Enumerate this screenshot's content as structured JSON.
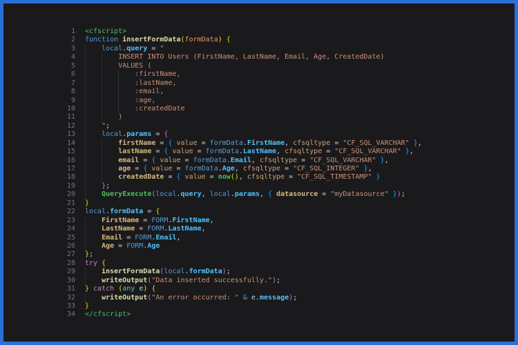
{
  "window": {
    "border_color": "#2a70d8",
    "background_color": "#1a1a1c",
    "gutter_color": "#6e7681",
    "language": "cfscript"
  },
  "palette": {
    "kw": "#569CD6",
    "v": "#569CD6",
    "pr": "#4FC1FF",
    "fn": "#DCDCAA",
    "param": "#E8956D",
    "key": "#D7BA7D",
    "attr": "#D2A176",
    "str": "#CE9178",
    "tag": "#4BC161",
    "grn": "#4BC161",
    "pink": "#C586C0",
    "teal": "#4EC9B0",
    "cy": "#9CDCFE",
    "p": "#D4D4D4",
    "g": "#FFD700",
    "o": "#DA70D6",
    "b": "#179FFF"
  },
  "code": {
    "lines": [
      {
        "n": "1",
        "t": [
          [
            "tag",
            "<cfscript>"
          ]
        ]
      },
      {
        "n": "2",
        "t": [
          [
            "kw",
            "function "
          ],
          [
            "fn",
            "insertFormData"
          ],
          [
            "g",
            "("
          ],
          [
            "param",
            "formData"
          ],
          [
            "g",
            ")"
          ],
          [
            "p",
            " "
          ],
          [
            "g",
            "{"
          ]
        ]
      },
      {
        "n": "3",
        "t": [
          [
            "p",
            "    "
          ],
          [
            "v",
            "local"
          ],
          [
            "p",
            "."
          ],
          [
            "pr",
            "query"
          ],
          [
            "p",
            " = "
          ],
          [
            "str",
            "\""
          ]
        ]
      },
      {
        "n": "4",
        "t": [
          [
            "str",
            "        INSERT INTO Users (FirstName, LastName, Email, Age, CreatedDate)"
          ]
        ]
      },
      {
        "n": "5",
        "t": [
          [
            "str",
            "        VALUES ("
          ]
        ]
      },
      {
        "n": "6",
        "t": [
          [
            "str",
            "            :firstName,"
          ]
        ]
      },
      {
        "n": "7",
        "t": [
          [
            "str",
            "            :lastName,"
          ]
        ]
      },
      {
        "n": "8",
        "t": [
          [
            "str",
            "            :email,"
          ]
        ]
      },
      {
        "n": "9",
        "t": [
          [
            "str",
            "            :age,"
          ]
        ]
      },
      {
        "n": "10",
        "t": [
          [
            "str",
            "            :createdDate"
          ]
        ]
      },
      {
        "n": "11",
        "t": [
          [
            "str",
            "        )"
          ]
        ]
      },
      {
        "n": "12",
        "t": [
          [
            "p",
            "    "
          ],
          [
            "str",
            "\""
          ],
          [
            "p",
            ";"
          ]
        ]
      },
      {
        "n": "13",
        "t": [
          [
            "p",
            "    "
          ],
          [
            "v",
            "local"
          ],
          [
            "p",
            "."
          ],
          [
            "pr",
            "params"
          ],
          [
            "p",
            " = "
          ],
          [
            "o",
            "{"
          ]
        ]
      },
      {
        "n": "14",
        "t": [
          [
            "p",
            "        "
          ],
          [
            "key",
            "firstName"
          ],
          [
            "p",
            " = "
          ],
          [
            "b",
            "{"
          ],
          [
            "p",
            " "
          ],
          [
            "attr",
            "value"
          ],
          [
            "p",
            " = "
          ],
          [
            "v",
            "formData"
          ],
          [
            "p",
            "."
          ],
          [
            "pr",
            "FirstName"
          ],
          [
            "p",
            ", "
          ],
          [
            "attr",
            "cfsqltype"
          ],
          [
            "p",
            " = "
          ],
          [
            "str",
            "\"CF_SQL_VARCHAR\""
          ],
          [
            "p",
            " "
          ],
          [
            "b",
            "}"
          ],
          [
            "p",
            ","
          ]
        ]
      },
      {
        "n": "15",
        "t": [
          [
            "p",
            "        "
          ],
          [
            "key",
            "lastName"
          ],
          [
            "p",
            " = "
          ],
          [
            "b",
            "{"
          ],
          [
            "p",
            " "
          ],
          [
            "attr",
            "value"
          ],
          [
            "p",
            " = "
          ],
          [
            "v",
            "formData"
          ],
          [
            "p",
            "."
          ],
          [
            "pr",
            "LastName"
          ],
          [
            "p",
            ", "
          ],
          [
            "attr",
            "cfsqltype"
          ],
          [
            "p",
            " = "
          ],
          [
            "str",
            "\"CF_SQL_VARCHAR\""
          ],
          [
            "p",
            " "
          ],
          [
            "b",
            "}"
          ],
          [
            "p",
            ","
          ]
        ]
      },
      {
        "n": "16",
        "t": [
          [
            "p",
            "        "
          ],
          [
            "key",
            "email"
          ],
          [
            "p",
            " = "
          ],
          [
            "b",
            "{"
          ],
          [
            "p",
            " "
          ],
          [
            "attr",
            "value"
          ],
          [
            "p",
            " = "
          ],
          [
            "v",
            "formData"
          ],
          [
            "p",
            "."
          ],
          [
            "pr",
            "Email"
          ],
          [
            "p",
            ", "
          ],
          [
            "attr",
            "cfsqltype"
          ],
          [
            "p",
            " = "
          ],
          [
            "str",
            "\"CF_SQL_VARCHAR\""
          ],
          [
            "p",
            " "
          ],
          [
            "b",
            "}"
          ],
          [
            "p",
            ","
          ]
        ]
      },
      {
        "n": "17",
        "t": [
          [
            "p",
            "        "
          ],
          [
            "key",
            "age"
          ],
          [
            "p",
            " = "
          ],
          [
            "b",
            "{"
          ],
          [
            "p",
            " "
          ],
          [
            "attr",
            "value"
          ],
          [
            "p",
            " = "
          ],
          [
            "v",
            "formData"
          ],
          [
            "p",
            "."
          ],
          [
            "pr",
            "Age"
          ],
          [
            "p",
            ", "
          ],
          [
            "attr",
            "cfsqltype"
          ],
          [
            "p",
            " = "
          ],
          [
            "str",
            "\"CF_SQL_INTEGER\""
          ],
          [
            "p",
            " "
          ],
          [
            "b",
            "}"
          ],
          [
            "p",
            ","
          ]
        ]
      },
      {
        "n": "18",
        "t": [
          [
            "p",
            "        "
          ],
          [
            "key",
            "createdDate"
          ],
          [
            "p",
            " = "
          ],
          [
            "b",
            "{"
          ],
          [
            "p",
            " "
          ],
          [
            "attr",
            "value"
          ],
          [
            "p",
            " = "
          ],
          [
            "grn",
            "now"
          ],
          [
            "g",
            "()"
          ],
          [
            "p",
            ", "
          ],
          [
            "attr",
            "cfsqltype"
          ],
          [
            "p",
            " = "
          ],
          [
            "str",
            "\"CF_SQL_TIMESTAMP\""
          ],
          [
            "p",
            " "
          ],
          [
            "b",
            "}"
          ]
        ]
      },
      {
        "n": "19",
        "t": [
          [
            "p",
            "    "
          ],
          [
            "o",
            "}"
          ],
          [
            "p",
            ";"
          ]
        ]
      },
      {
        "n": "20",
        "t": [
          [
            "p",
            "    "
          ],
          [
            "grn",
            "QueryExecute"
          ],
          [
            "o",
            "("
          ],
          [
            "v",
            "local"
          ],
          [
            "p",
            "."
          ],
          [
            "pr",
            "query"
          ],
          [
            "p",
            ", "
          ],
          [
            "v",
            "local"
          ],
          [
            "p",
            "."
          ],
          [
            "pr",
            "params"
          ],
          [
            "p",
            ", "
          ],
          [
            "b",
            "{"
          ],
          [
            "p",
            " "
          ],
          [
            "key",
            "datasource"
          ],
          [
            "p",
            " = "
          ],
          [
            "str",
            "\"myDatasource\""
          ],
          [
            "p",
            " "
          ],
          [
            "b",
            "}"
          ],
          [
            "o",
            ")"
          ],
          [
            "p",
            ";"
          ]
        ]
      },
      {
        "n": "21",
        "t": [
          [
            "g",
            "}"
          ]
        ]
      },
      {
        "n": "22",
        "t": [
          [
            "v",
            "local"
          ],
          [
            "p",
            "."
          ],
          [
            "pr",
            "formData"
          ],
          [
            "p",
            " = "
          ],
          [
            "g",
            "{"
          ]
        ]
      },
      {
        "n": "23",
        "t": [
          [
            "p",
            "    "
          ],
          [
            "key",
            "FirstName"
          ],
          [
            "p",
            " = "
          ],
          [
            "v",
            "FORM"
          ],
          [
            "p",
            "."
          ],
          [
            "pr",
            "FirstName"
          ],
          [
            "p",
            ","
          ]
        ]
      },
      {
        "n": "24",
        "t": [
          [
            "p",
            "    "
          ],
          [
            "key",
            "LastName"
          ],
          [
            "p",
            " = "
          ],
          [
            "v",
            "FORM"
          ],
          [
            "p",
            "."
          ],
          [
            "pr",
            "LastName"
          ],
          [
            "p",
            ","
          ]
        ]
      },
      {
        "n": "25",
        "t": [
          [
            "p",
            "    "
          ],
          [
            "key",
            "Email"
          ],
          [
            "p",
            " = "
          ],
          [
            "v",
            "FORM"
          ],
          [
            "p",
            "."
          ],
          [
            "pr",
            "Email"
          ],
          [
            "p",
            ","
          ]
        ]
      },
      {
        "n": "26",
        "t": [
          [
            "p",
            "    "
          ],
          [
            "key",
            "Age"
          ],
          [
            "p",
            " = "
          ],
          [
            "v",
            "FORM"
          ],
          [
            "p",
            "."
          ],
          [
            "pr",
            "Age"
          ]
        ]
      },
      {
        "n": "27",
        "t": [
          [
            "g",
            "}"
          ],
          [
            "p",
            ";"
          ]
        ]
      },
      {
        "n": "28",
        "t": [
          [
            "pink",
            "try"
          ],
          [
            "p",
            " "
          ],
          [
            "g",
            "{"
          ]
        ]
      },
      {
        "n": "29",
        "t": [
          [
            "p",
            "    "
          ],
          [
            "fn",
            "insertFormData"
          ],
          [
            "o",
            "("
          ],
          [
            "v",
            "local"
          ],
          [
            "p",
            "."
          ],
          [
            "pr",
            "formData"
          ],
          [
            "o",
            ")"
          ],
          [
            "p",
            ";"
          ]
        ]
      },
      {
        "n": "30",
        "t": [
          [
            "p",
            "    "
          ],
          [
            "fn",
            "writeOutput"
          ],
          [
            "o",
            "("
          ],
          [
            "str",
            "\"Data inserted successfully.\""
          ],
          [
            "o",
            ")"
          ],
          [
            "p",
            ";"
          ]
        ]
      },
      {
        "n": "31",
        "t": [
          [
            "g",
            "}"
          ],
          [
            "p",
            " "
          ],
          [
            "pink",
            "catch"
          ],
          [
            "p",
            " "
          ],
          [
            "g",
            "("
          ],
          [
            "teal",
            "any"
          ],
          [
            "p",
            " "
          ],
          [
            "cy",
            "e"
          ],
          [
            "g",
            ")"
          ],
          [
            "p",
            " "
          ],
          [
            "g",
            "{"
          ]
        ]
      },
      {
        "n": "32",
        "t": [
          [
            "p",
            "    "
          ],
          [
            "fn",
            "writeOutput"
          ],
          [
            "o",
            "("
          ],
          [
            "str",
            "\"An error occurred: \""
          ],
          [
            "p",
            " "
          ],
          [
            "v",
            "&"
          ],
          [
            "p",
            " "
          ],
          [
            "cy",
            "e"
          ],
          [
            "p",
            "."
          ],
          [
            "pr",
            "message"
          ],
          [
            "o",
            ")"
          ],
          [
            "p",
            ";"
          ]
        ]
      },
      {
        "n": "33",
        "t": [
          [
            "g",
            "}"
          ]
        ]
      },
      {
        "n": "34",
        "t": [
          [
            "tag",
            "</cfscript>"
          ]
        ]
      }
    ]
  }
}
